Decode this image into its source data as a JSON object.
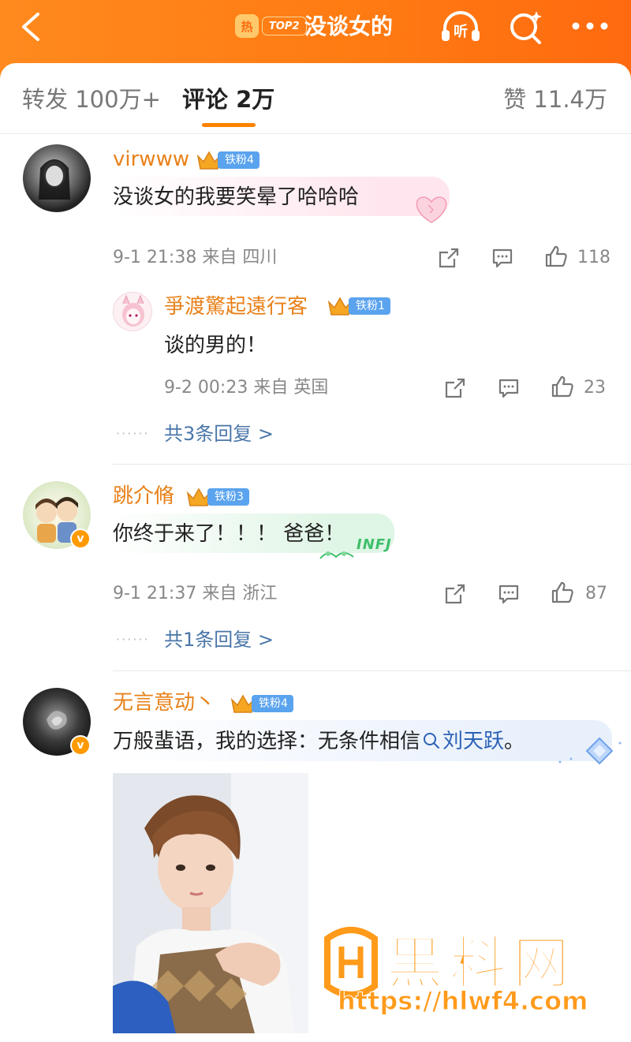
{
  "header": {
    "hot_label": "热",
    "rank_label": "TOP2",
    "topic_title": "没谈女的"
  },
  "tabs": {
    "repost": "转发 100万+",
    "comment": "评论 2万",
    "like": "赞 11.4万"
  },
  "comments": [
    {
      "user": "virwww",
      "fan_badge": "铁粉4",
      "text": "没谈女的我要笑晕了哈哈哈",
      "time_location": "9-1 21:38  来自 四川",
      "likes": "118",
      "reply": {
        "user": "爭渡驚起遠行客",
        "fan_badge": "铁粉1",
        "text": "谈的男的！",
        "time_location": "9-2 00:23  来自 英国",
        "likes": "23"
      },
      "more_replies": "共3条回复 >"
    },
    {
      "user": "跳介脩",
      "fan_badge": "铁粉3",
      "text": "你终于来了！！！ 爸爸！",
      "bubble_tag": "INFJ",
      "time_location": "9-1 21:37  来自 浙江",
      "likes": "87",
      "more_replies": "共1条回复 >"
    },
    {
      "user": "无言意动丶",
      "fan_badge": "铁粉4",
      "text_before": "万般蜚语，我的选择：无条件相信",
      "topic_link": "刘天跃",
      "text_after": "。"
    }
  ],
  "watermark": {
    "text": "黑料网",
    "url": "https://hlwf4.com"
  },
  "colors": {
    "header": "#ff7a12",
    "username": "#e8811a",
    "fan_badge": "#5aa3ee",
    "link": "#4a76a8",
    "tab_underline": "#ff8200"
  }
}
